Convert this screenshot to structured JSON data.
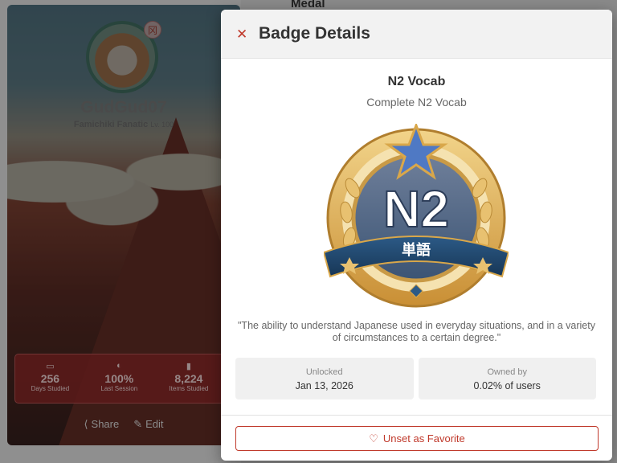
{
  "background": {
    "medal_heading": "Medal",
    "profile": {
      "username": "GudGud07",
      "title": "Famichiki Fanatic",
      "level": "Lv. 100",
      "stamp": "冈",
      "stats": [
        {
          "icon": "calendar-icon",
          "value": "256",
          "label": "Days Studied"
        },
        {
          "icon": "speedometer-icon",
          "value": "100%",
          "label": "Last Session"
        },
        {
          "icon": "bar-chart-icon",
          "value": "8,224",
          "label": "Items Studied"
        }
      ],
      "actions": {
        "share": "Share",
        "edit": "Edit"
      }
    }
  },
  "modal": {
    "title": "Badge Details",
    "close_icon": "close-icon",
    "badge": {
      "name": "N2 Vocab",
      "description": "Complete N2 Vocab",
      "art_text": "N2",
      "art_ribbon_text": "単語",
      "quote": "\"The ability to understand Japanese used in everyday situations, and in a variety of circumstances to a certain degree.\""
    },
    "unlocked": {
      "label": "Unlocked",
      "value": "Jan 13, 2026"
    },
    "owned_by": {
      "label": "Owned by",
      "value": "0.02% of users"
    },
    "favorite_button": "Unset as Favorite"
  },
  "colors": {
    "accent": "#c0392b",
    "badge_gold": "#d9a74a",
    "badge_navy": "#1f3e63"
  }
}
